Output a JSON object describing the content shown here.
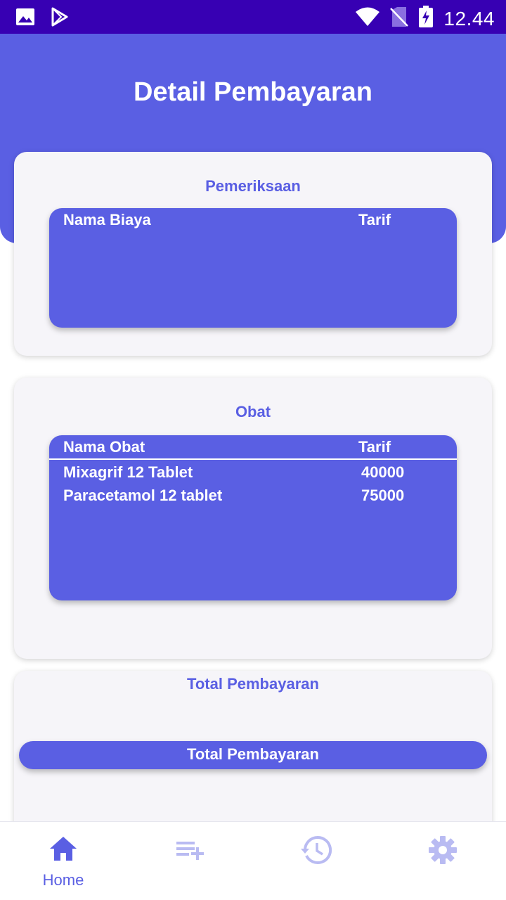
{
  "status_bar": {
    "time": "12.44"
  },
  "page_title": "Detail Pembayaran",
  "pemeriksaan": {
    "title": "Pemeriksaan",
    "columns": [
      "Nama Biaya",
      "Tarif"
    ],
    "rows": []
  },
  "obat": {
    "title": "Obat",
    "columns": [
      "Nama Obat",
      "Tarif"
    ],
    "rows": [
      {
        "name": "Mixagrif 12 Tablet",
        "tarif": "40000"
      },
      {
        "name": "Paracetamol 12 tablet",
        "tarif": "75000"
      }
    ]
  },
  "total": {
    "title": "Total Pembayaran",
    "button_label": "Total Pembayaran"
  },
  "bottom_nav": {
    "items": [
      {
        "icon": "home-icon",
        "label": "Home",
        "active": true
      },
      {
        "icon": "playlist-add-icon",
        "label": "",
        "active": false
      },
      {
        "icon": "history-icon",
        "label": "",
        "active": false
      },
      {
        "icon": "gear-icon",
        "label": "",
        "active": false
      }
    ]
  },
  "colors": {
    "primary": "#5a5fe3",
    "status_bar": "#3700b3",
    "card": "#f6f5f9",
    "inactive_icon": "#b9bbf2"
  }
}
